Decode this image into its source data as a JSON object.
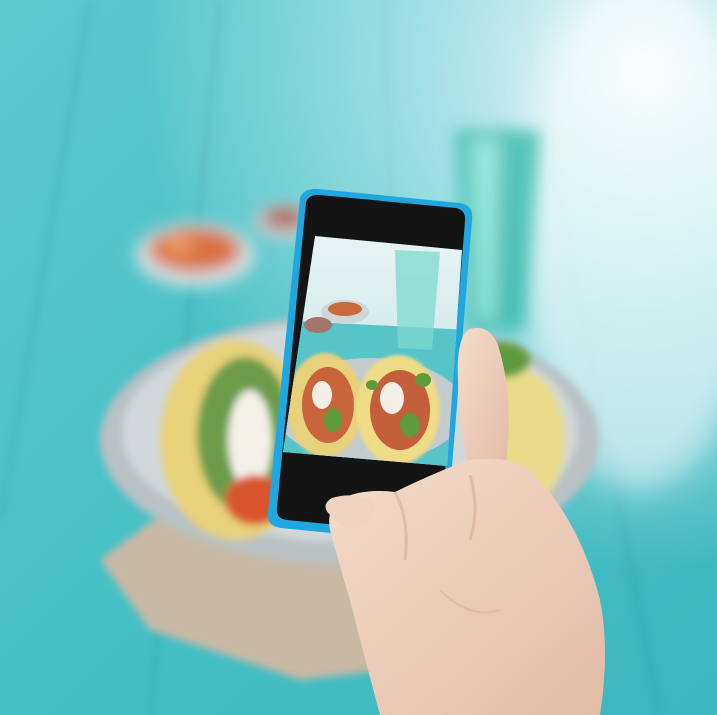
{
  "scene": {
    "subject": "hand-holding-smartphone-photographing-tacos",
    "colors": {
      "table": "#46c3c9",
      "table_light": "#8fdde0",
      "phone_case": "#1fa8df",
      "phone_body": "#151515",
      "skin": "#efd2c0",
      "skin_shadow": "#d9b39f",
      "tortilla": "#e8d27a",
      "plate": "#c9cfd1",
      "napkin": "#c8b9a5",
      "salsa": "#d9713f"
    }
  }
}
